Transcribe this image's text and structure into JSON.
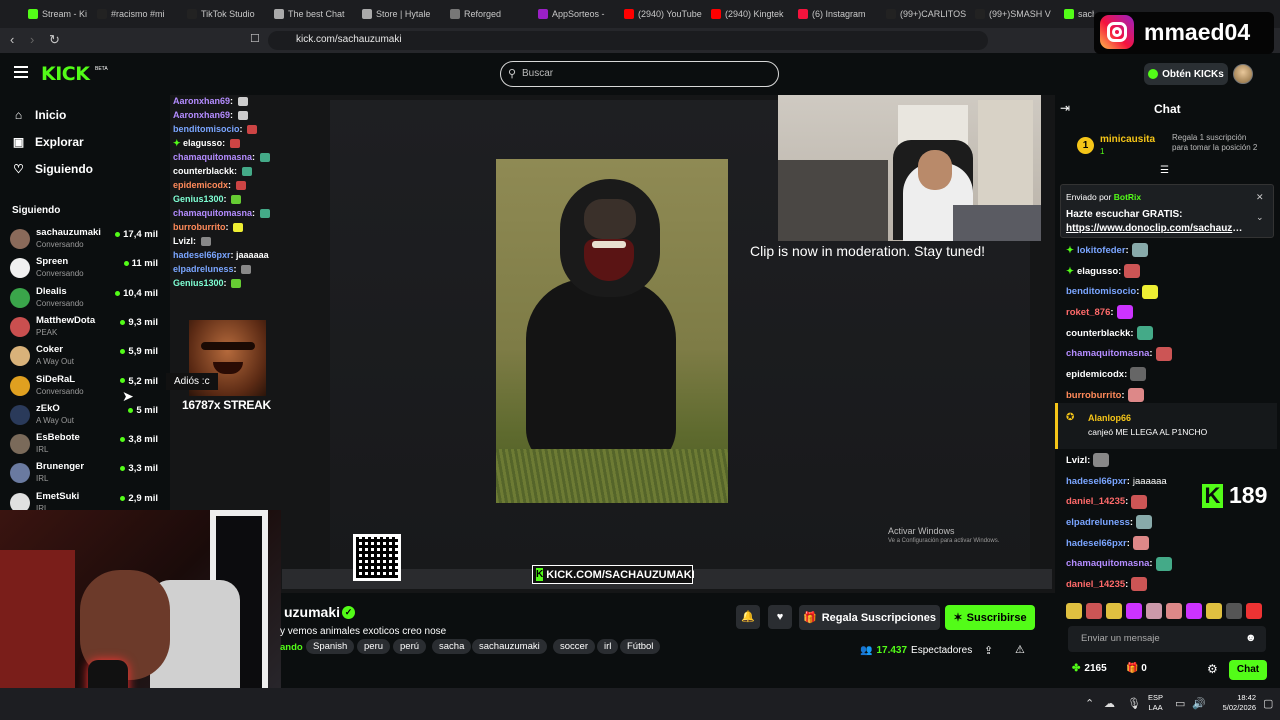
{
  "browser": {
    "tabs": [
      {
        "label": "Stream - Ki",
        "color": "#53fc18"
      },
      {
        "label": "#racismo #mi",
        "color": "#222"
      },
      {
        "label": "TikTok Studio",
        "color": "#222"
      },
      {
        "label": "The best Chat",
        "color": "#aaa"
      },
      {
        "label": "Store | Hytale",
        "color": "#aaa"
      },
      {
        "label": "Reforged",
        "color": "#777"
      },
      {
        "label": "AppSorteos -",
        "color": "#9b20c6"
      },
      {
        "label": "(2940) YouTube",
        "color": "#ff0000"
      },
      {
        "label": "(2940) Kingtek",
        "color": "#ff0000"
      },
      {
        "label": "(6) Instagram",
        "color": "#f5133d"
      },
      {
        "label": "(99+)CARLITOS",
        "color": "#222"
      },
      {
        "label": "(99+)SMASH V",
        "color": "#222"
      },
      {
        "label": "sacha",
        "color": "#53fc18"
      }
    ],
    "url": "kick.com/sachauzumaki"
  },
  "overlay_badge": {
    "instagram_handle": "mmaed04"
  },
  "header": {
    "logo": "KICK",
    "logo_tag": "BETA",
    "search_placeholder": "Buscar",
    "kicks_button": "Obtén KICKs"
  },
  "sidebar": {
    "nav": [
      {
        "label": "Inicio",
        "icon": "home-icon"
      },
      {
        "label": "Explorar",
        "icon": "compass-icon"
      },
      {
        "label": "Siguiendo",
        "icon": "heart-icon"
      }
    ],
    "following_heading": "Siguiendo",
    "following": [
      {
        "name": "sachauzumaki",
        "category": "Conversando",
        "viewers": "17,4 mil",
        "avatar": "#8a6a5a"
      },
      {
        "name": "Spreen",
        "category": "Conversando",
        "viewers": "11 mil",
        "avatar": "#f0f0f0"
      },
      {
        "name": "Dlealis",
        "category": "Conversando",
        "viewers": "10,4 mil",
        "avatar": "#3aa54a"
      },
      {
        "name": "MatthewDota",
        "category": "PEAK",
        "viewers": "9,3 mil",
        "avatar": "#c94f4f"
      },
      {
        "name": "Coker",
        "category": "A Way Out",
        "viewers": "5,9 mil",
        "avatar": "#d9b27a"
      },
      {
        "name": "SiDeRaL",
        "category": "Conversando",
        "viewers": "5,2 mil",
        "avatar": "#e0a020"
      },
      {
        "name": "zEkO",
        "category": "A Way Out",
        "viewers": "5 mil",
        "avatar": "#2a3a5a"
      },
      {
        "name": "EsBebote",
        "category": "IRL",
        "viewers": "3,8 mil",
        "avatar": "#7a6a5a"
      },
      {
        "name": "Brunenger",
        "category": "IRL",
        "viewers": "3,3 mil",
        "avatar": "#6a7aa0"
      },
      {
        "name": "EmetSuki",
        "category": "IRL",
        "viewers": "2,9 mil",
        "avatar": "#e0e0e0"
      }
    ]
  },
  "stream_overlay": {
    "chat": [
      {
        "user": "Aaronxhan69",
        "color": "#b48cff",
        "emote": "#ccc"
      },
      {
        "user": "Aaronxhan69",
        "color": "#b48cff",
        "emote": "#ccc"
      },
      {
        "user": "benditomisocio",
        "color": "#7aa5ff",
        "emote": "#c44"
      },
      {
        "user": "elagusso",
        "color": "#fff",
        "emote": "#c44",
        "prefix": "✦"
      },
      {
        "user": "chamaquitomasna",
        "color": "#b48cff",
        "emote": "#4a8"
      },
      {
        "user": "counterblackk",
        "color": "#fff",
        "emote": "#4a8"
      },
      {
        "user": "epidemicodx",
        "color": "#ff8a5a",
        "emote": "#c44"
      },
      {
        "user": "Genius1300",
        "color": "#7fffd4",
        "emote": "#6c3"
      },
      {
        "user": "chamaquitomasna",
        "color": "#b48cff",
        "emote": "#4a8"
      },
      {
        "user": "burroburrito",
        "color": "#ff8a5a",
        "emote": "#ee3"
      },
      {
        "user": "Lvizl",
        "color": "#fff",
        "emote": "#888"
      },
      {
        "user": "hadesel66pxr",
        "color": "#7aa5ff",
        "text": "jaaaaaa"
      },
      {
        "user": "elpadreluness",
        "color": "#7aa5ff",
        "emote": "#888"
      },
      {
        "user": "Genius1300",
        "color": "#7fffd4",
        "emote": "#6c3"
      }
    ],
    "tooltip": "Adiós :c",
    "streak": "16787x STREAK",
    "clip_message": "Clip is now in moderation. Stay tuned!",
    "url_banner": "KICK.COM/SACHAUZUMAKI",
    "activate_windows": "Activar Windows",
    "activate_windows_sub": "Ve a Configuración para activar Windows."
  },
  "channel": {
    "name": "uzumaki",
    "title": "y vemos animales exoticos creo nose",
    "playing_fragment": "ando",
    "tags": [
      "Spanish",
      "peru",
      "perú",
      "sacha",
      "sachauzumaki",
      "soccer",
      "irl",
      "Fútbol"
    ],
    "viewers_count": "17.437",
    "viewers_label": "Espectadores",
    "gift_button": "Regala Suscripciones",
    "subscribe_button": "Suscribirse"
  },
  "chat": {
    "title": "Chat",
    "pinned_top": {
      "rank": "1",
      "name": "minicausita",
      "sub": "1",
      "text": "Regala 1 suscripción para tomar la posición 2"
    },
    "bot": {
      "sent_by": "Enviado por",
      "bot_name": "BotRix",
      "message": "Hazte escuchar GRATIS:",
      "link": "https://www.donoclip.com/sachauzumaki"
    },
    "messages": [
      {
        "user": "lokitofeder",
        "color": "#7aa5ff",
        "emote": "#8aa",
        "prefix": "✦"
      },
      {
        "user": "elagusso",
        "color": "#fff",
        "emote": "#c55",
        "prefix": "✦"
      },
      {
        "user": "benditomisocio",
        "color": "#7aa5ff",
        "emote": "#ee3"
      },
      {
        "user": "roket_876",
        "color": "#ff6a6a",
        "emote": "#c3f"
      },
      {
        "user": "counterblackk",
        "color": "#fff",
        "emote": "#4a8"
      },
      {
        "user": "chamaquitomasna",
        "color": "#b48cff",
        "emote": "#c55"
      },
      {
        "user": "epidemicodx",
        "color": "#fff",
        "emote": "#666"
      },
      {
        "user": "burroburrito",
        "color": "#ff8a5a",
        "emote": "#d88"
      }
    ],
    "redeem": {
      "user": "Alanlop66",
      "text": "canjeó ME LLEGA AL P1NCHO"
    },
    "messages_after": [
      {
        "user": "Lvizl",
        "color": "#fff",
        "emote": "#888"
      },
      {
        "user": "hadesel66pxr",
        "color": "#7aa5ff",
        "text": "jaaaaaa"
      },
      {
        "user": "daniel_14235",
        "color": "#ff6a6a",
        "emote": "#c55"
      },
      {
        "user": "elpadreluness",
        "color": "#7aa5ff",
        "emote": "#8aa"
      },
      {
        "user": "hadesel66pxr",
        "color": "#7aa5ff",
        "emote": "#d88"
      },
      {
        "user": "chamaquitomasna",
        "color": "#b48cff",
        "emote": "#4a8"
      },
      {
        "user": "daniel_14235",
        "color": "#ff6a6a",
        "emote": "#c55"
      }
    ],
    "kicks_count": "189",
    "emote_bar": [
      "#e0c040",
      "#c55",
      "#e0c040",
      "#c3f",
      "#c9a",
      "#d88",
      "#c3f",
      "#e0c040",
      "#555",
      "#e33"
    ],
    "input_placeholder": "Enviar un mensaje",
    "points": "2165",
    "subs": "0",
    "send_button": "Chat"
  },
  "taskbar": {
    "lang": "ESP",
    "lang_sub": "LAA",
    "time": "18:42",
    "date": "5/02/2026"
  }
}
